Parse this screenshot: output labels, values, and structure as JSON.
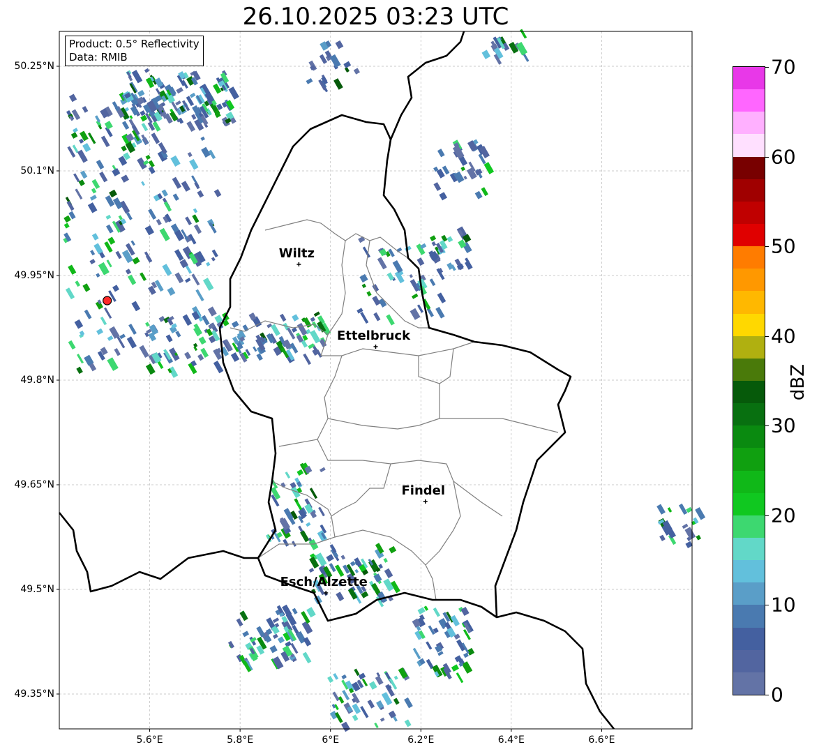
{
  "title": "26.10.2025 03:23 UTC",
  "info_box": {
    "line1": "Product: 0.5° Reflectivity",
    "line2": "Data: RMIB"
  },
  "map_extent": {
    "lon": [
      5.4,
      6.8
    ],
    "lat": [
      49.3,
      50.3
    ]
  },
  "x_ticks": [
    {
      "lon": 5.6,
      "label": "5.6°E"
    },
    {
      "lon": 5.8,
      "label": "5.8°E"
    },
    {
      "lon": 6.0,
      "label": "6°E"
    },
    {
      "lon": 6.2,
      "label": "6.2°E"
    },
    {
      "lon": 6.4,
      "label": "6.4°E"
    },
    {
      "lon": 6.6,
      "label": "6.6°E"
    }
  ],
  "y_ticks": [
    {
      "lat": 50.25,
      "label": "50.25°N"
    },
    {
      "lat": 50.1,
      "label": "50.1°N"
    },
    {
      "lat": 49.95,
      "label": "49.95°N"
    },
    {
      "lat": 49.8,
      "label": "49.8°N"
    },
    {
      "lat": 49.65,
      "label": "49.65°N"
    },
    {
      "lat": 49.5,
      "label": "49.5°N"
    },
    {
      "lat": 49.35,
      "label": "49.35°N"
    }
  ],
  "cities": [
    {
      "name": "Wiltz",
      "lon": 5.93,
      "lat": 49.966
    },
    {
      "name": "Ettelbruck",
      "lon": 6.1,
      "lat": 49.848
    },
    {
      "name": "Findel",
      "lon": 6.21,
      "lat": 49.626
    },
    {
      "name": "Esch/Alzette",
      "lon": 5.99,
      "lat": 49.495
    }
  ],
  "radar_site": {
    "lon": 5.506,
    "lat": 49.914,
    "color": "#ff2a2a"
  },
  "colorbar": {
    "label": "dBZ",
    "ticks": [
      "0",
      "10",
      "20",
      "30",
      "40",
      "50",
      "60",
      "70"
    ],
    "colors": [
      "#6373a6",
      "#5265a0",
      "#4460a0",
      "#4a7ab0",
      "#5a9ec8",
      "#62c0dc",
      "#62d8c8",
      "#3dd870",
      "#10c820",
      "#10b818",
      "#10a010",
      "#0a8a10",
      "#087010",
      "#065a0a",
      "#4a7a0a",
      "#b0b010",
      "#ffd800",
      "#ffb800",
      "#ff9800",
      "#ff7c00",
      "#e00000",
      "#c00000",
      "#a00000",
      "#780000",
      "#ffe0ff",
      "#ffb0ff",
      "#ff66ff",
      "#e838e8"
    ]
  }
}
